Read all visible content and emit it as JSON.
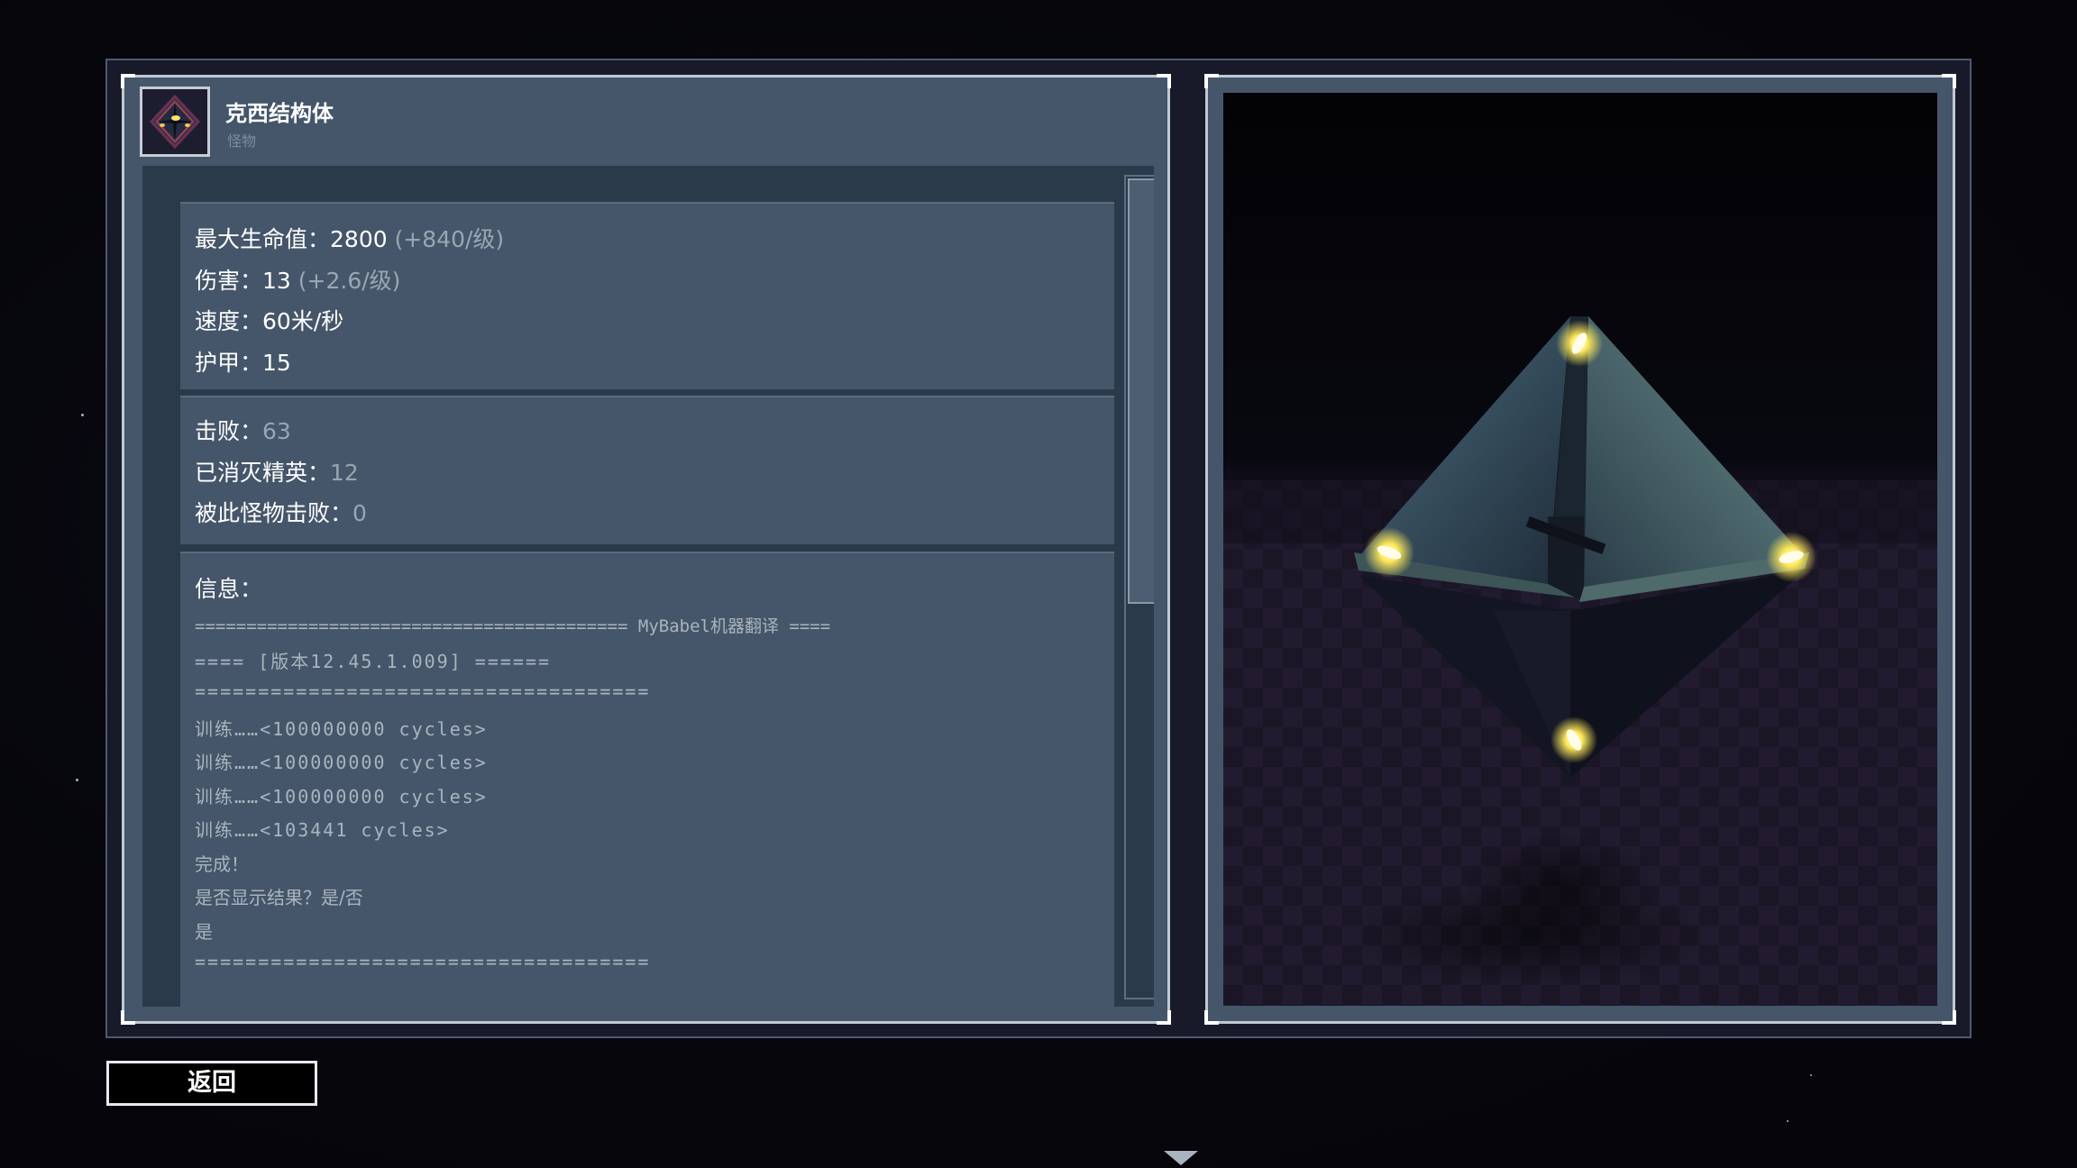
{
  "monster": {
    "name": "克西结构体",
    "type": "怪物",
    "portrait_icon": "xi-construct-portrait-icon"
  },
  "stats": {
    "max_hp": {
      "label": "最大生命值：",
      "value": "2800",
      "growth": "(+840/级)"
    },
    "damage": {
      "label": "伤害：",
      "value": "13",
      "growth": "(+2.6/级)"
    },
    "speed": {
      "label": "速度：",
      "value": "60米/秒"
    },
    "armor": {
      "label": "护甲：",
      "value": "15"
    }
  },
  "record": {
    "kills": {
      "label": "击败：",
      "value": "63"
    },
    "elite_kills": {
      "label": "已消灭精英：",
      "value": "12"
    },
    "deaths": {
      "label": "被此怪物击败：",
      "value": "0"
    }
  },
  "info": {
    "title": "信息：",
    "lines": [
      "========================================== MyBabel机器翻译 ====",
      "==== [版本12.45.1.009] ======",
      "====================================",
      "训练……<100000000 cycles>",
      "训练……<100000000 cycles>",
      "训练……<100000000 cycles>",
      "训练……<103441 cycles>",
      "完成！",
      "是否显示结果？是/否",
      "是",
      "===================================="
    ]
  },
  "scrollbar": {
    "position_fraction": 0.0,
    "visible_fraction": 0.52
  },
  "buttons": {
    "back_label": "返回"
  },
  "colors": {
    "panel": "#45566a",
    "well": "#2b3a4b",
    "glow": "#ffe95a",
    "faded_text": "#9aa6b2"
  }
}
